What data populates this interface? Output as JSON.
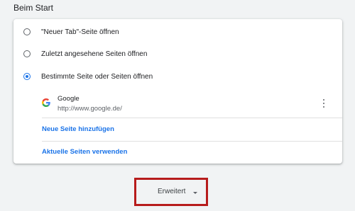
{
  "section": {
    "title": "Beim Start"
  },
  "startup": {
    "options": [
      {
        "label": "\"Neuer Tab\"-Seite öffnen",
        "checked": false
      },
      {
        "label": "Zuletzt angesehene Seiten öffnen",
        "checked": false
      },
      {
        "label": "Bestimmte Seite oder Seiten öffnen",
        "checked": true
      }
    ],
    "pages": [
      {
        "name": "Google",
        "url": "http://www.google.de/",
        "icon": "google-favicon"
      }
    ],
    "add_page_label": "Neue Seite hinzufügen",
    "use_current_label": "Aktuelle Seiten verwenden",
    "more_icon": "kebab-menu-icon"
  },
  "advanced": {
    "label": "Erweitert",
    "icon": "caret-down-icon",
    "highlight_color": "#b71c1c"
  },
  "colors": {
    "accent": "#1a73e8",
    "background": "#f1f3f4"
  }
}
